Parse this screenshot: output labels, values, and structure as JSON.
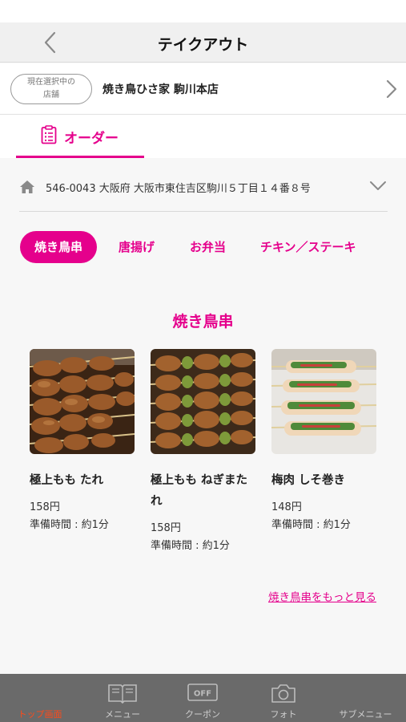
{
  "header": {
    "title": "テイクアウト"
  },
  "store": {
    "badge": "現在選択中の\n店舗",
    "name": "焼き鳥ひさ家 駒川本店"
  },
  "tabs": [
    {
      "label": "オーダー",
      "active": true
    }
  ],
  "address": "546-0043 大阪府 大阪市東住吉区駒川５丁目１４番８号",
  "categories": [
    {
      "label": "焼き鳥串",
      "active": true
    },
    {
      "label": "唐揚げ",
      "active": false
    },
    {
      "label": "お弁当",
      "active": false
    },
    {
      "label": "チキン／ステーキ",
      "active": false
    }
  ],
  "section": {
    "title": "焼き鳥串"
  },
  "products": [
    {
      "name": "極上もも たれ",
      "price": "158円",
      "prep_time": "準備時間 : 約1分",
      "image": "grilled-skewers-tare"
    },
    {
      "name": "極上もも ねぎまたれ",
      "price": "158円",
      "prep_time": "準備時間 : 約1分",
      "image": "grilled-negima-skewers"
    },
    {
      "name": "梅肉 しそ巻き",
      "price": "148円",
      "prep_time": "準備時間 : 約1分",
      "image": "shiso-ume-skewers"
    }
  ],
  "more_link": "焼き鳥串をもっと見る",
  "bottom_nav": [
    {
      "label": "トップ画面",
      "icon": "home-icon",
      "active": true
    },
    {
      "label": "メニュー",
      "icon": "book-icon",
      "active": false
    },
    {
      "label": "クーポン",
      "icon": "coupon-off-icon",
      "active": false
    },
    {
      "label": "フォト",
      "icon": "camera-icon",
      "active": false
    },
    {
      "label": "サブメニュー",
      "icon": "submenu-icon",
      "active": false
    }
  ],
  "colors": {
    "accent": "#e5008c",
    "bottom_nav_bg": "#6a6a6a",
    "active_nav": "#ff4a1a"
  }
}
